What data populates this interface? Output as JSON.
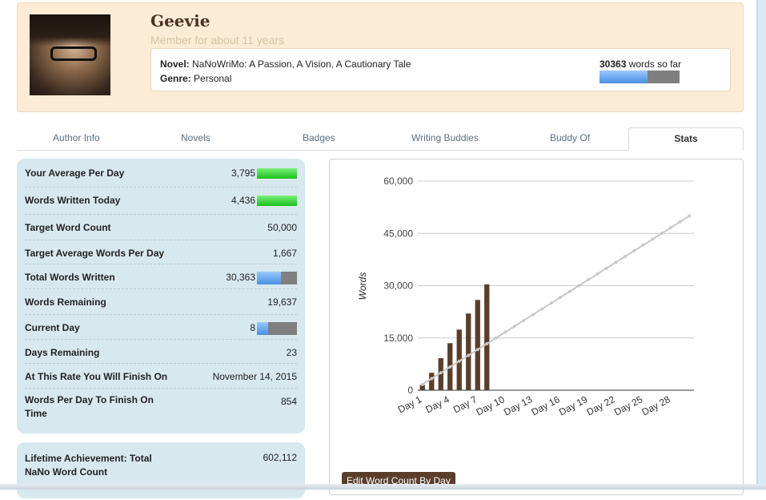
{
  "profile": {
    "username": "Geevie",
    "member_since": "Member for about 11 years",
    "novel_label": "Novel:",
    "novel_title": "NaNoWriMo: A Passion, A Vision, A Cautionary Tale",
    "genre_label": "Genre:",
    "genre": "Personal",
    "word_count": "30363",
    "word_count_suffix": "words so far",
    "progress_fraction": 0.6
  },
  "tabs": [
    "Author Info",
    "Novels",
    "Badges",
    "Writing Buddies",
    "Buddy Of",
    "Stats"
  ],
  "active_tab": "Stats",
  "stats": [
    {
      "label": "Your Average Per Day",
      "value": "3,795",
      "bar": "green"
    },
    {
      "label": "Words Written Today",
      "value": "4,436",
      "bar": "green"
    },
    {
      "label": "Target Word Count",
      "value": "50,000"
    },
    {
      "label": "Target Average Words Per Day",
      "value": "1,667"
    },
    {
      "label": "Total Words Written",
      "value": "30,363",
      "bar": "progress",
      "fraction": 0.6
    },
    {
      "label": "Words Remaining",
      "value": "19,637"
    },
    {
      "label": "Current Day",
      "value": "8",
      "bar": "progress",
      "fraction": 0.27
    },
    {
      "label": "Days Remaining",
      "value": "23"
    },
    {
      "label": "At This Rate You Will Finish On",
      "value": "November 14, 2015"
    },
    {
      "label": "Words Per Day To Finish On Time",
      "value": "854"
    }
  ],
  "lifetime": {
    "label": "Lifetime Achievement: Total NaNo Word Count",
    "value": "602,112"
  },
  "edit_button": "Edit Word Count By Day",
  "colors": {
    "bar": "#5a3e2b",
    "target": "#c8c8c8",
    "accent": "#4a8fe0"
  },
  "chart_data": {
    "type": "bar",
    "ylabel": "Words",
    "ylim": [
      0,
      60000
    ],
    "yticks": [
      "0",
      "15,000",
      "30,000",
      "45,000",
      "60,000"
    ],
    "ytick_values": [
      0,
      15000,
      30000,
      45000,
      60000
    ],
    "xticks": [
      "Day 1",
      "Day 4",
      "Day 7",
      "Day 10",
      "Day 13",
      "Day 16",
      "Day 19",
      "Day 22",
      "Day 25",
      "Day 28"
    ],
    "days": 30,
    "series": [
      {
        "values": [
          1500,
          5000,
          9200,
          13500,
          17400,
          22000,
          25900,
          30363,
          0,
          0,
          0,
          0,
          0,
          0,
          0,
          0,
          0,
          0,
          0,
          0,
          0,
          0,
          0,
          0,
          0,
          0,
          0,
          0,
          0,
          0
        ]
      },
      {
        "values": [
          1667,
          3333,
          5000,
          6667,
          8333,
          10000,
          11667,
          13333,
          15000,
          16667,
          18333,
          20000,
          21667,
          23333,
          25000,
          26667,
          28333,
          30000,
          31667,
          33333,
          35000,
          36667,
          38333,
          40000,
          41667,
          43333,
          45000,
          46667,
          48333,
          50000
        ]
      }
    ]
  }
}
